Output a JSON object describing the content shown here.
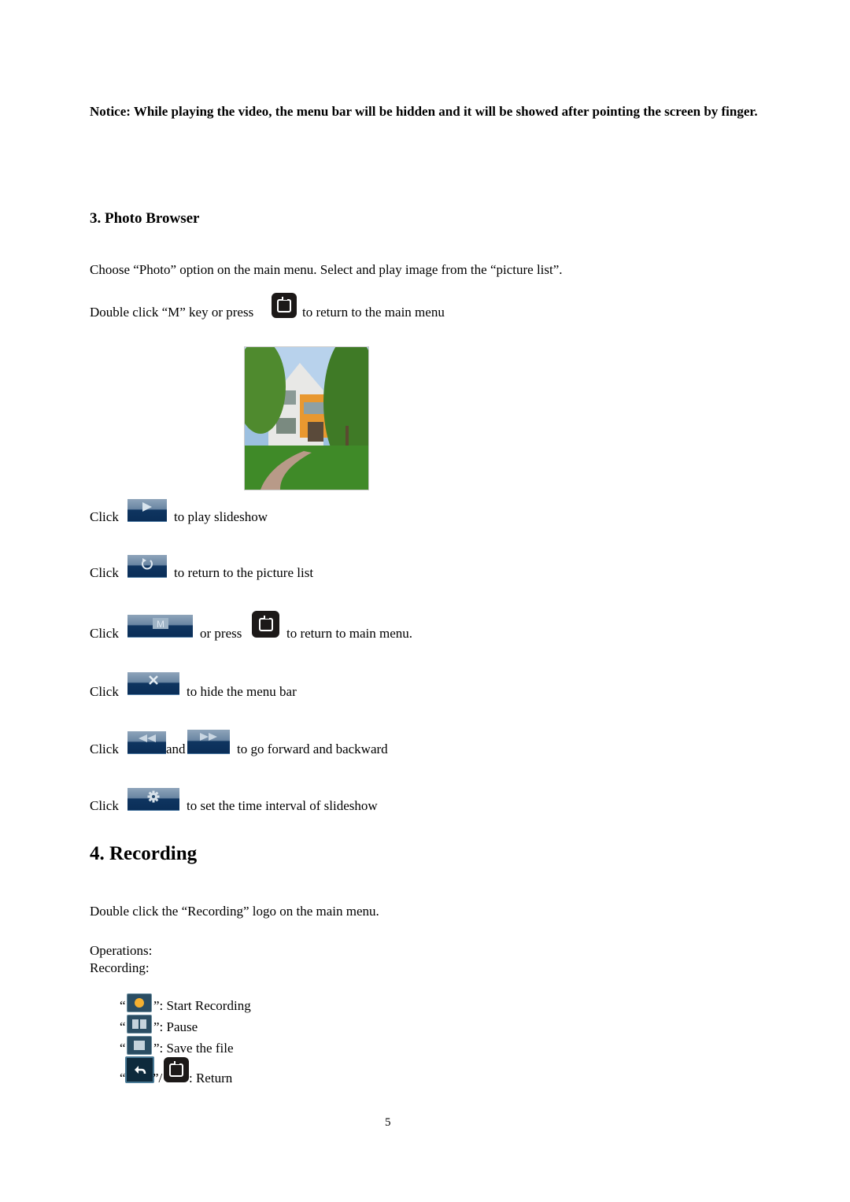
{
  "notice": "Notice: While playing the video, the menu bar will be hidden and it will be showed after pointing the screen by finger.",
  "section3": {
    "title": "3. Photo Browser",
    "intro": "Choose “Photo” option on the main menu. Select and play image from the “picture list”.",
    "return_line": {
      "before": "Double click “M” key or press",
      "after": "to return to the main menu"
    },
    "photo_alt": "building-photo",
    "instructions": [
      {
        "click": "Click",
        "text": "to play slideshow",
        "icon": "play-icon"
      },
      {
        "click": "Click",
        "text": "to return to the picture list",
        "icon": "rotate-icon"
      },
      {
        "click": "Click",
        "middle": "or press",
        "text": "to return to main menu.",
        "icon": "m-icon"
      },
      {
        "click": "Click",
        "text": "to hide the menu bar",
        "icon": "x-icon"
      },
      {
        "click": "Click",
        "middle": "and",
        "text": "to go forward and backward",
        "icon": "rewind-icon"
      },
      {
        "click": "Click",
        "text": "to set the time interval of slideshow",
        "icon": "gear-icon"
      }
    ]
  },
  "section4": {
    "title": "4. Recording",
    "intro": "Double click the “Recording” logo on the main menu.",
    "operations_label": "Operations:",
    "recording_label": "Recording:",
    "ops": [
      {
        "open": "“",
        "close": "”: Start Recording",
        "icon": "record-icon"
      },
      {
        "open": "“",
        "close": "”: Pause",
        "icon": "pause-icon"
      },
      {
        "open": "“",
        "close": "”: Save the file",
        "icon": "stop-icon"
      },
      {
        "open": "“",
        "close": "”/",
        "after": ": Return",
        "icon": "back-icon"
      }
    ]
  },
  "page_number": "5"
}
